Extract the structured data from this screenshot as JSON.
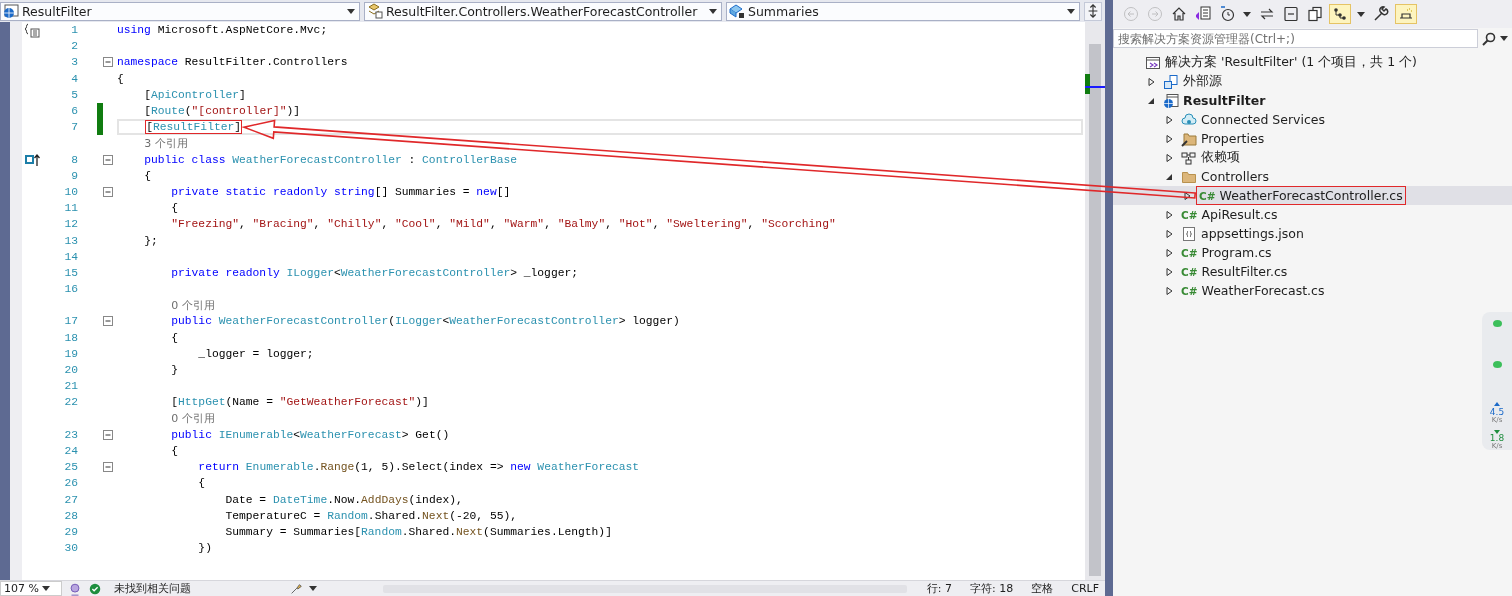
{
  "editor": {
    "nav_bar": {
      "project": "ResultFilter",
      "type": "ResultFilter.Controllers.WeatherForecastController",
      "member": "Summaries"
    },
    "lines": [
      {
        "kind": "code",
        "number": "1",
        "glyph": {
          "kind": "braces"
        },
        "changed": false,
        "foldable": false,
        "current": false,
        "callout": false,
        "tokens": [
          {
            "kind": "kw",
            "text": "using"
          },
          {
            "kind": "plain",
            "text": " Microsoft.AspNetCore.Mvc;"
          }
        ]
      },
      {
        "kind": "code",
        "number": "2",
        "changed": false,
        "foldable": false,
        "current": false,
        "callout": false
      },
      {
        "kind": "code",
        "number": "3",
        "changed": false,
        "foldable": true,
        "current": false,
        "callout": false,
        "tokens": [
          {
            "kind": "kw",
            "text": "namespace"
          },
          {
            "kind": "plain",
            "text": " ResultFilter.Controllers"
          }
        ]
      },
      {
        "kind": "code",
        "number": "4",
        "changed": false,
        "foldable": false,
        "current": false,
        "callout": false,
        "tokens": [
          {
            "kind": "plain",
            "text": "{"
          }
        ]
      },
      {
        "kind": "code",
        "number": "5",
        "changed": false,
        "foldable": false,
        "current": false,
        "callout": false,
        "tokens": [
          {
            "kind": "plain",
            "text": "    ["
          },
          {
            "kind": "type",
            "text": "ApiController"
          },
          {
            "kind": "plain",
            "text": "]"
          }
        ]
      },
      {
        "kind": "code",
        "number": "6",
        "changed": true,
        "foldable": false,
        "current": false,
        "callout": false,
        "tokens": [
          {
            "kind": "plain",
            "text": "    ["
          },
          {
            "kind": "type",
            "text": "Route"
          },
          {
            "kind": "plain",
            "text": "("
          },
          {
            "kind": "str",
            "text": "\"[controller]\""
          },
          {
            "kind": "plain",
            "text": ")]"
          }
        ]
      },
      {
        "kind": "code",
        "number": "7",
        "changed": true,
        "foldable": false,
        "current": true,
        "callout": true,
        "tokens": [
          {
            "kind": "plain",
            "text": "    ["
          },
          {
            "kind": "type",
            "text": "ResultFilter"
          },
          {
            "kind": "plain",
            "text": "]"
          }
        ]
      },
      {
        "kind": "lens",
        "tokens": [
          {
            "kind": "lens",
            "text": "    3 个引用"
          }
        ]
      },
      {
        "kind": "code",
        "number": "8",
        "glyph": {
          "kind": "override"
        },
        "changed": false,
        "foldable": true,
        "current": false,
        "callout": false,
        "tokens": [
          {
            "kind": "kw",
            "text": "    public class"
          },
          {
            "kind": "type",
            "text": " WeatherForecastController"
          },
          {
            "kind": "plain",
            "text": " : "
          },
          {
            "kind": "type",
            "text": "ControllerBase"
          }
        ]
      },
      {
        "kind": "code",
        "number": "9",
        "changed": false,
        "foldable": false,
        "current": false,
        "callout": false,
        "tokens": [
          {
            "kind": "plain",
            "text": "    {"
          }
        ]
      },
      {
        "kind": "code",
        "number": "10",
        "changed": false,
        "foldable": true,
        "current": false,
        "callout": false,
        "tokens": [
          {
            "kind": "kw",
            "text": "        private static readonly string"
          },
          {
            "kind": "plain",
            "text": "[] Summaries = "
          },
          {
            "kind": "kw",
            "text": "new"
          },
          {
            "kind": "plain",
            "text": "[]"
          }
        ]
      },
      {
        "kind": "code",
        "number": "11",
        "changed": false,
        "foldable": false,
        "current": false,
        "callout": false,
        "tokens": [
          {
            "kind": "plain",
            "text": "        {"
          }
        ]
      },
      {
        "kind": "code",
        "number": "12",
        "changed": false,
        "foldable": false,
        "current": false,
        "callout": false,
        "tokens": [
          {
            "kind": "str",
            "text": "        \"Freezing\""
          },
          {
            "kind": "plain",
            "text": ", "
          },
          {
            "kind": "str",
            "text": "\"Bracing\""
          },
          {
            "kind": "plain",
            "text": ", "
          },
          {
            "kind": "str",
            "text": "\"Chilly\""
          },
          {
            "kind": "plain",
            "text": ", "
          },
          {
            "kind": "str",
            "text": "\"Cool\""
          },
          {
            "kind": "plain",
            "text": ", "
          },
          {
            "kind": "str",
            "text": "\"Mild\""
          },
          {
            "kind": "plain",
            "text": ", "
          },
          {
            "kind": "str",
            "text": "\"Warm\""
          },
          {
            "kind": "plain",
            "text": ", "
          },
          {
            "kind": "str",
            "text": "\"Balmy\""
          },
          {
            "kind": "plain",
            "text": ", "
          },
          {
            "kind": "str",
            "text": "\"Hot\""
          },
          {
            "kind": "plain",
            "text": ", "
          },
          {
            "kind": "str",
            "text": "\"Sweltering\""
          },
          {
            "kind": "plain",
            "text": ", "
          },
          {
            "kind": "str",
            "text": "\"Scorching\""
          }
        ]
      },
      {
        "kind": "code",
        "number": "13",
        "changed": false,
        "foldable": false,
        "current": false,
        "callout": false,
        "tokens": [
          {
            "kind": "plain",
            "text": "    };"
          }
        ]
      },
      {
        "kind": "code",
        "number": "14",
        "changed": false,
        "foldable": false,
        "current": false,
        "callout": false
      },
      {
        "kind": "code",
        "number": "15",
        "changed": false,
        "foldable": false,
        "current": false,
        "callout": false,
        "tokens": [
          {
            "kind": "kw",
            "text": "        private readonly"
          },
          {
            "kind": "type",
            "text": " ILogger"
          },
          {
            "kind": "plain",
            "text": "<"
          },
          {
            "kind": "type",
            "text": "WeatherForecastController"
          },
          {
            "kind": "plain",
            "text": "> _logger;"
          }
        ]
      },
      {
        "kind": "code",
        "number": "16",
        "changed": false,
        "foldable": false,
        "current": false,
        "callout": false
      },
      {
        "kind": "lens",
        "tokens": [
          {
            "kind": "lens",
            "text": "        0 个引用"
          }
        ]
      },
      {
        "kind": "code",
        "number": "17",
        "changed": false,
        "foldable": true,
        "current": false,
        "callout": false,
        "tokens": [
          {
            "kind": "kw",
            "text": "        public"
          },
          {
            "kind": "type",
            "text": " WeatherForecastController"
          },
          {
            "kind": "plain",
            "text": "("
          },
          {
            "kind": "type",
            "text": "ILogger"
          },
          {
            "kind": "plain",
            "text": "<"
          },
          {
            "kind": "type",
            "text": "WeatherForecastController"
          },
          {
            "kind": "plain",
            "text": "> logger)"
          }
        ]
      },
      {
        "kind": "code",
        "number": "18",
        "changed": false,
        "foldable": false,
        "current": false,
        "callout": false,
        "tokens": [
          {
            "kind": "plain",
            "text": "        {"
          }
        ]
      },
      {
        "kind": "code",
        "number": "19",
        "changed": false,
        "foldable": false,
        "current": false,
        "callout": false,
        "tokens": [
          {
            "kind": "plain",
            "text": "            _logger = logger;"
          }
        ]
      },
      {
        "kind": "code",
        "number": "20",
        "changed": false,
        "foldable": false,
        "current": false,
        "callout": false,
        "tokens": [
          {
            "kind": "plain",
            "text": "        }"
          }
        ]
      },
      {
        "kind": "code",
        "number": "21",
        "changed": false,
        "foldable": false,
        "current": false,
        "callout": false
      },
      {
        "kind": "code",
        "number": "22",
        "changed": false,
        "foldable": false,
        "current": false,
        "callout": false,
        "tokens": [
          {
            "kind": "plain",
            "text": "        ["
          },
          {
            "kind": "type",
            "text": "HttpGet"
          },
          {
            "kind": "plain",
            "text": "(Name = "
          },
          {
            "kind": "str",
            "text": "\"GetWeatherForecast\""
          },
          {
            "kind": "plain",
            "text": ")]"
          }
        ]
      },
      {
        "kind": "lens",
        "tokens": [
          {
            "kind": "lens",
            "text": "        0 个引用"
          }
        ]
      },
      {
        "kind": "code",
        "number": "23",
        "changed": false,
        "foldable": true,
        "current": false,
        "callout": false,
        "tokens": [
          {
            "kind": "kw",
            "text": "        public"
          },
          {
            "kind": "type",
            "text": " IEnumerable"
          },
          {
            "kind": "plain",
            "text": "<"
          },
          {
            "kind": "type",
            "text": "WeatherForecast"
          },
          {
            "kind": "plain",
            "text": "> Get()"
          }
        ]
      },
      {
        "kind": "code",
        "number": "24",
        "changed": false,
        "foldable": false,
        "current": false,
        "callout": false,
        "tokens": [
          {
            "kind": "plain",
            "text": "        {"
          }
        ]
      },
      {
        "kind": "code",
        "number": "25",
        "changed": false,
        "foldable": true,
        "current": false,
        "callout": false,
        "tokens": [
          {
            "kind": "kw",
            "text": "            return"
          },
          {
            "kind": "type",
            "text": " Enumerable"
          },
          {
            "kind": "plain",
            "text": "."
          },
          {
            "kind": "method",
            "text": "Range"
          },
          {
            "kind": "plain",
            "text": "(1, 5).Select(index => "
          },
          {
            "kind": "kw",
            "text": "new"
          },
          {
            "kind": "type",
            "text": " WeatherForecast"
          }
        ]
      },
      {
        "kind": "code",
        "number": "26",
        "changed": false,
        "foldable": false,
        "current": false,
        "callout": false,
        "tokens": [
          {
            "kind": "plain",
            "text": "            {"
          }
        ]
      },
      {
        "kind": "code",
        "number": "27",
        "changed": false,
        "foldable": false,
        "current": false,
        "callout": false,
        "tokens": [
          {
            "kind": "plain",
            "text": "                Date = "
          },
          {
            "kind": "type",
            "text": "DateTime"
          },
          {
            "kind": "plain",
            "text": ".Now."
          },
          {
            "kind": "method",
            "text": "AddDays"
          },
          {
            "kind": "plain",
            "text": "(index),"
          }
        ]
      },
      {
        "kind": "code",
        "number": "28",
        "changed": false,
        "foldable": false,
        "current": false,
        "callout": false,
        "tokens": [
          {
            "kind": "plain",
            "text": "                TemperatureC = "
          },
          {
            "kind": "type",
            "text": "Random"
          },
          {
            "kind": "plain",
            "text": ".Shared."
          },
          {
            "kind": "method",
            "text": "Next"
          },
          {
            "kind": "plain",
            "text": "(-20, 55),"
          }
        ]
      },
      {
        "kind": "code",
        "number": "29",
        "changed": false,
        "foldable": false,
        "current": false,
        "callout": false,
        "tokens": [
          {
            "kind": "plain",
            "text": "                Summary = Summaries["
          },
          {
            "kind": "type",
            "text": "Random"
          },
          {
            "kind": "plain",
            "text": ".Shared."
          },
          {
            "kind": "method",
            "text": "Next"
          },
          {
            "kind": "plain",
            "text": "(Summaries.Length)]"
          }
        ]
      },
      {
        "kind": "code",
        "number": "30",
        "changed": false,
        "foldable": false,
        "current": false,
        "callout": false,
        "tokens": [
          {
            "kind": "plain",
            "text": "            })"
          }
        ]
      }
    ],
    "status_bar": {
      "zoom": "107 %",
      "issues": "未找到相关问题",
      "line": "行: 7",
      "column": "字符: 18",
      "indent": "空格",
      "line_ending": "CRLF"
    }
  },
  "solution_explorer": {
    "toolbar": [
      {
        "kind": "back",
        "disabled": true,
        "on": false
      },
      {
        "kind": "forward",
        "disabled": true,
        "on": false
      },
      {
        "kind": "home",
        "disabled": false,
        "on": false
      },
      {
        "kind": "switch-views",
        "disabled": false,
        "on": false
      },
      {
        "kind": "pending-changes",
        "disabled": false,
        "on": false
      },
      {
        "kind": "dropdown",
        "disabled": false,
        "on": false
      },
      {
        "kind": "sync",
        "disabled": false,
        "on": false
      },
      {
        "kind": "collapse",
        "disabled": false,
        "on": false
      },
      {
        "kind": "copy",
        "disabled": false,
        "on": false
      },
      {
        "kind": "show-all",
        "disabled": false,
        "on": true
      },
      {
        "kind": "dropdown",
        "disabled": false,
        "on": false
      },
      {
        "kind": "properties",
        "disabled": false,
        "on": false
      },
      {
        "kind": "preview",
        "disabled": false,
        "on": true
      }
    ],
    "search": {
      "placeholder": "搜索解决方案资源管理器(Ctrl+;)"
    },
    "tree": [
      {
        "kind": "solution",
        "label": "解决方案 'ResultFilter' (1 个项目，共 1 个)",
        "selected": false,
        "callout": false,
        "children": [
          {
            "kind": "external",
            "label": "外部源",
            "expanded": false,
            "selected": false,
            "callout": false
          },
          {
            "kind": "project",
            "label": "ResultFilter",
            "expanded": true,
            "selected": false,
            "callout": false,
            "children": [
              {
                "kind": "services",
                "label": "Connected Services",
                "expanded": false,
                "selected": false,
                "callout": false
              },
              {
                "kind": "properties",
                "label": "Properties",
                "expanded": false,
                "selected": false,
                "callout": false
              },
              {
                "kind": "dependencies",
                "label": "依赖项",
                "expanded": false,
                "selected": false,
                "callout": false
              },
              {
                "kind": "folder",
                "label": "Controllers",
                "expanded": true,
                "selected": false,
                "callout": false,
                "children": [
                  {
                    "kind": "csharp",
                    "badge": "C#",
                    "label": "WeatherForecastController.cs",
                    "expanded": false,
                    "selected": true,
                    "callout": true
                  }
                ]
              },
              {
                "kind": "csharp",
                "badge": "C#",
                "label": "ApiResult.cs",
                "expanded": false,
                "selected": false,
                "callout": false
              },
              {
                "kind": "json",
                "label": "appsettings.json",
                "expanded": false,
                "selected": false,
                "callout": false
              },
              {
                "kind": "csharp",
                "badge": "C#",
                "label": "Program.cs",
                "expanded": false,
                "selected": false,
                "callout": false
              },
              {
                "kind": "csharp",
                "badge": "C#",
                "label": "ResultFilter.cs",
                "expanded": false,
                "selected": false,
                "callout": false
              },
              {
                "kind": "csharp",
                "badge": "C#",
                "label": "WeatherForecast.cs",
                "expanded": false,
                "selected": false,
                "callout": false
              }
            ]
          }
        ]
      }
    ]
  },
  "network_widget": {
    "readings": [
      {
        "kind": "upload",
        "value": "4.5",
        "unit": "K/s"
      },
      {
        "kind": "download",
        "value": "1.8",
        "unit": "K/s"
      }
    ]
  }
}
